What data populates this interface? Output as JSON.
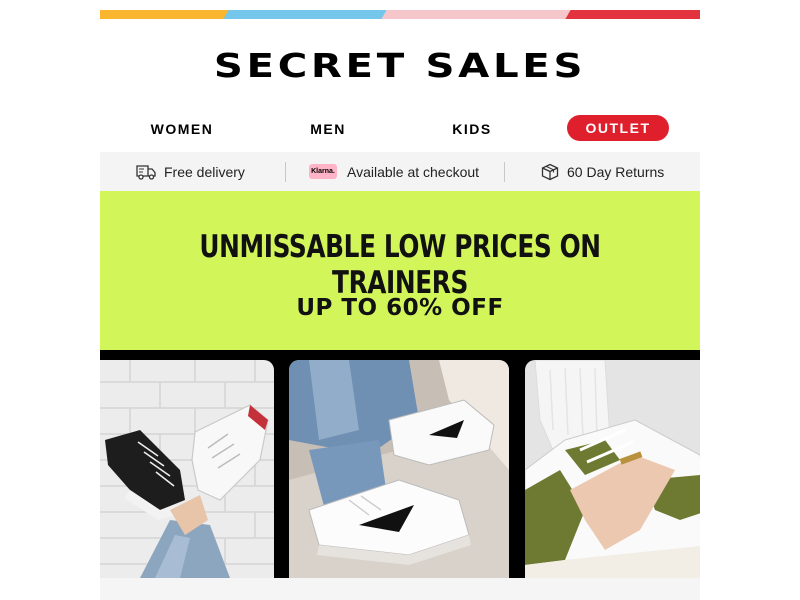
{
  "colors": {
    "stripe": [
      "#fbb62f",
      "#74c7ea",
      "#f5c6ca",
      "#e2333f"
    ],
    "outlet_bg": "#e01f2d",
    "hero_bg": "#d2f55a",
    "gallery_bg": "#000000"
  },
  "header": {
    "brand": "SECRET SALES"
  },
  "nav": {
    "items": [
      {
        "label": "WOMEN"
      },
      {
        "label": "MEN"
      },
      {
        "label": "KIDS"
      },
      {
        "label": "OUTLET"
      }
    ]
  },
  "benefits": {
    "items": [
      {
        "icon": "delivery-truck-icon",
        "label": "Free delivery"
      },
      {
        "icon": "klarna-logo",
        "badge": "Klarna.",
        "label": "Available at checkout"
      },
      {
        "icon": "returns-box-icon",
        "label": "60 Day Returns"
      }
    ]
  },
  "hero": {
    "headline": "UNMISSABLE LOW PRICES ON TRAINERS",
    "subheadline": "UP TO 60% OFF"
  },
  "gallery": {
    "items": [
      {
        "icon": "converse-sneakers-photo"
      },
      {
        "icon": "nike-sneakers-photo"
      },
      {
        "icon": "puma-sneakers-photo"
      }
    ]
  }
}
